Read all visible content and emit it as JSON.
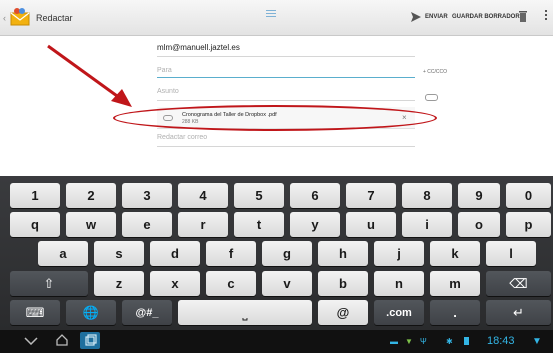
{
  "actionbar": {
    "back_icon": "chevron-left-icon",
    "app_icon": "hotmail-app-icon",
    "title": "Redactar",
    "menu_icon": "hamburger-icon",
    "send_icon": "send-icon",
    "send_label": "ENVIAR",
    "draft_label": "GUARDAR BORRADOR",
    "trash_icon": "trash-icon",
    "overflow_icon": "overflow-menu-icon"
  },
  "compose": {
    "from": "mlm@manuell.jaztel.es",
    "to_placeholder": "Para",
    "cc_bcc": "+ CC/CCO",
    "subject_placeholder": "Asunto",
    "attach_icon": "paperclip-icon",
    "attachment": {
      "name": "Cronograma del Taller de Dropbox .pdf",
      "size": "288 KB",
      "remove_icon": "close-icon"
    },
    "body_placeholder": "Redactar correo"
  },
  "annotation": {
    "color": "#c0161a"
  },
  "keyboard": {
    "row1": [
      "1",
      "2",
      "3",
      "4",
      "5",
      "6",
      "7",
      "8",
      "9",
      "0"
    ],
    "row2": [
      "q",
      "w",
      "e",
      "r",
      "t",
      "y",
      "u",
      "i",
      "o",
      "p"
    ],
    "row3": [
      "a",
      "s",
      "d",
      "f",
      "g",
      "h",
      "j",
      "k",
      "l"
    ],
    "row4": [
      "z",
      "x",
      "c",
      "v",
      "b",
      "n",
      "m"
    ],
    "shift": "⇧",
    "backspace": "⌫",
    "enter": "↵",
    "settings": "⌨",
    "globe": "🌐",
    "symbols": "@#_",
    "space": "⎵",
    "at": "@",
    "dotcom": ".com",
    "period": ".",
    "row1_hints": [
      "",
      "",
      "",
      "",
      "",
      "",
      "",
      "",
      "",
      ""
    ]
  },
  "systembar": {
    "back_icon": "back-icon",
    "home_icon": "home-icon",
    "recents_icon": "recents-icon",
    "clock": "18:43",
    "wifi_icon": "wifi-icon",
    "bluetooth_icon": "bluetooth-icon",
    "battery_icon": "battery-icon",
    "accent": "#33b5e5"
  }
}
